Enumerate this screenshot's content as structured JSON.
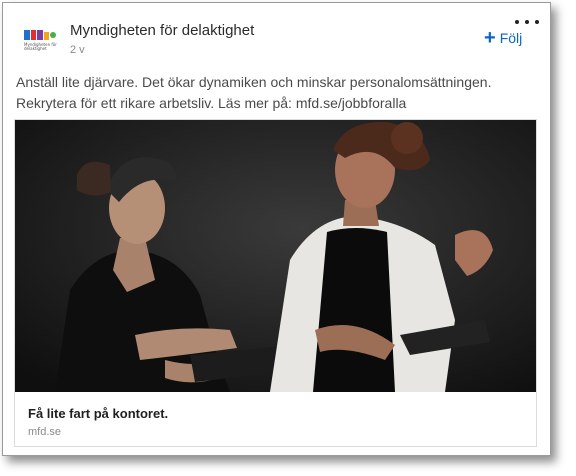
{
  "post": {
    "author": {
      "name": "Myndigheten för delaktighet",
      "logo_caption": "Myndigheten för delaktighet",
      "age": "2 v"
    },
    "follow_label": "Följ",
    "menu_icon": "more-dots-icon",
    "text_lines": [
      "Anställ lite djärvare. Det ökar dynamiken och minskar personalomsättningen.",
      "Rekrytera för ett rikare arbetsliv. Läs mer på: mfd.se/jobbforalla"
    ]
  },
  "link_card": {
    "title": "Få lite fart på kontoret.",
    "domain": "mfd.se"
  },
  "colors": {
    "accent": "#0a66c2",
    "logo_blue": "#1e73c8",
    "logo_red": "#e0312e",
    "logo_purple": "#7a3fa0"
  }
}
